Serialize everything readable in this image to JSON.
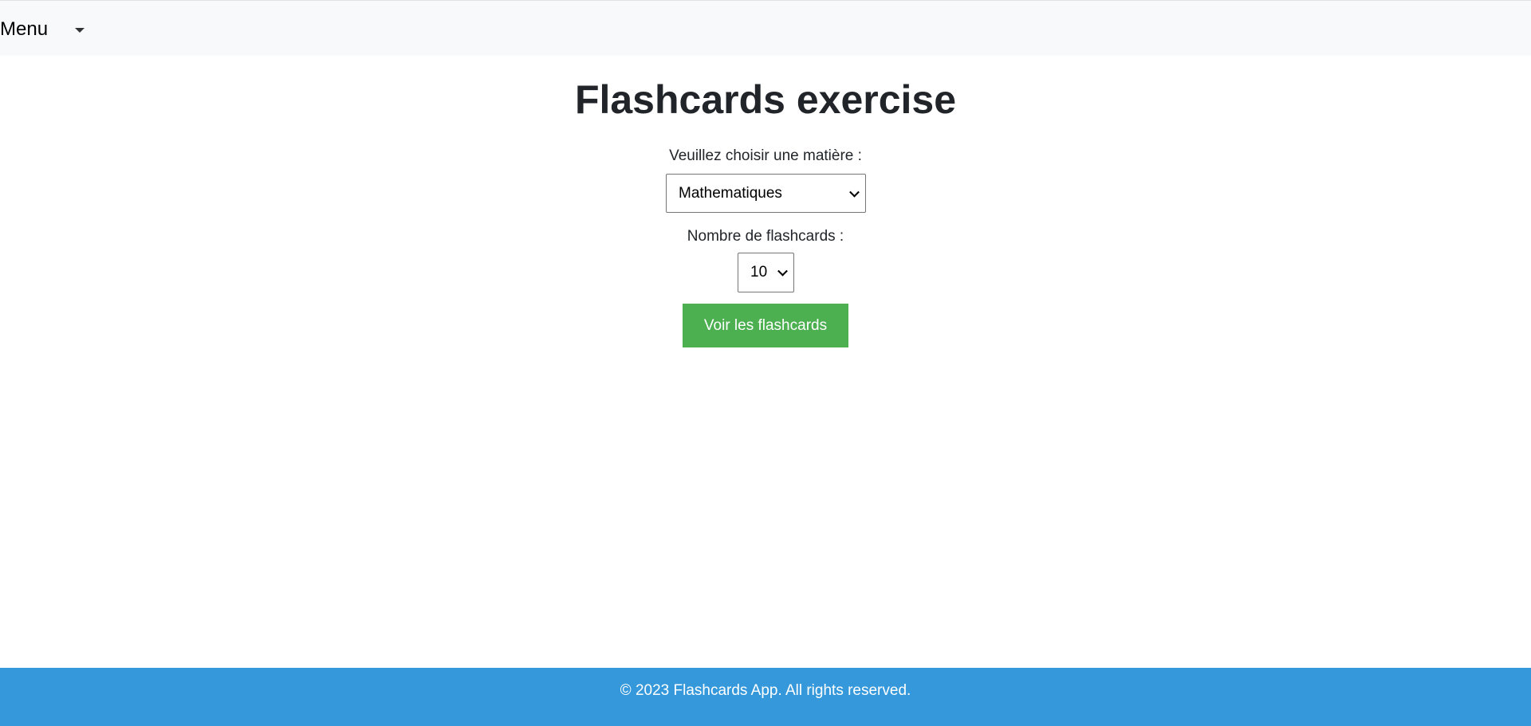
{
  "navbar": {
    "menu_label": "Menu"
  },
  "main": {
    "title": "Flashcards exercise",
    "subject_label": "Veuillez choisir une matière :",
    "subject_value": "Mathematiques",
    "count_label": "Nombre de flashcards :",
    "count_value": "10",
    "submit_label": "Voir les flashcards",
    "submit_color": "#4caf50"
  },
  "footer": {
    "text": "© 2023 Flashcards App. All rights reserved.",
    "color": "#3498db"
  }
}
